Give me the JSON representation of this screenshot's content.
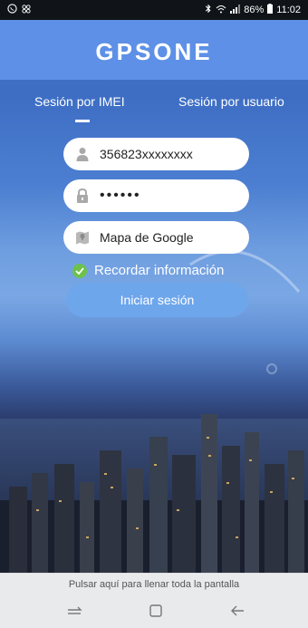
{
  "status_bar": {
    "left_icons": [
      "whatsapp-icon",
      "link-icon"
    ],
    "battery": "86%",
    "time": "11:02",
    "icons": [
      "bluetooth-icon",
      "wifi-icon",
      "signal-icon",
      "battery-icon"
    ]
  },
  "app": {
    "title": "GPSONE",
    "tabs": [
      {
        "label": "Sesión por IMEI",
        "active": true
      },
      {
        "label": "Sesión por usuario",
        "active": false
      }
    ],
    "fields": {
      "imei": {
        "value": "356823xxxxxxxx",
        "icon": "user-icon"
      },
      "password": {
        "value": "••••••",
        "icon": "lock-icon"
      },
      "map": {
        "value": "Mapa de Google",
        "icon": "map-icon"
      }
    },
    "remember": {
      "label": "Recordar información",
      "checked": true
    },
    "login_button": "Iniciar sesión"
  },
  "fill_screen_hint": "Pulsar aquí para llenar toda la pantalla",
  "nav": {
    "icons": [
      "recent-apps-icon",
      "home-icon",
      "back-icon"
    ]
  },
  "colors": {
    "header": "#5d90e6",
    "button": "#6ea6ec",
    "check": "#6cc24a"
  }
}
